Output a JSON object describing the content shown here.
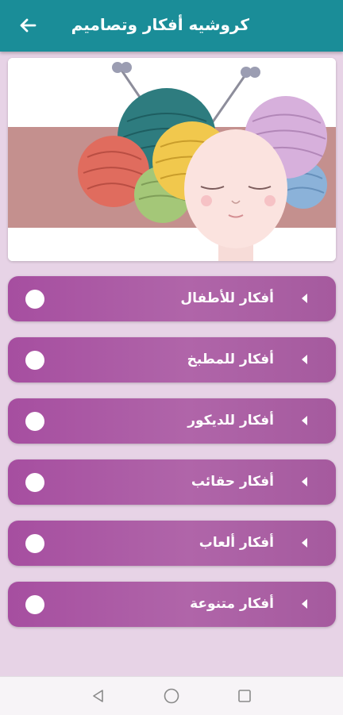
{
  "appbar": {
    "title": "كروشيه أفكار وتصاميم",
    "back_icon": "arrow-left-icon",
    "background_color": "#1a8d98"
  },
  "hero": {
    "illustration": "yarn-balls-head-illustration"
  },
  "menu": {
    "items": [
      {
        "label": "أفكار للأطفال"
      },
      {
        "label": "أفكار للمطبخ"
      },
      {
        "label": "أفكار للديكور"
      },
      {
        "label": "أفكار حقائب"
      },
      {
        "label": "أفكار ألعاب"
      },
      {
        "label": "أفكار متنوعة"
      }
    ],
    "item_color": "#a8569f"
  },
  "navbar": {
    "back_icon": "nav-back-triangle-icon",
    "home_icon": "nav-home-circle-icon",
    "recents_icon": "nav-recents-square-icon"
  }
}
